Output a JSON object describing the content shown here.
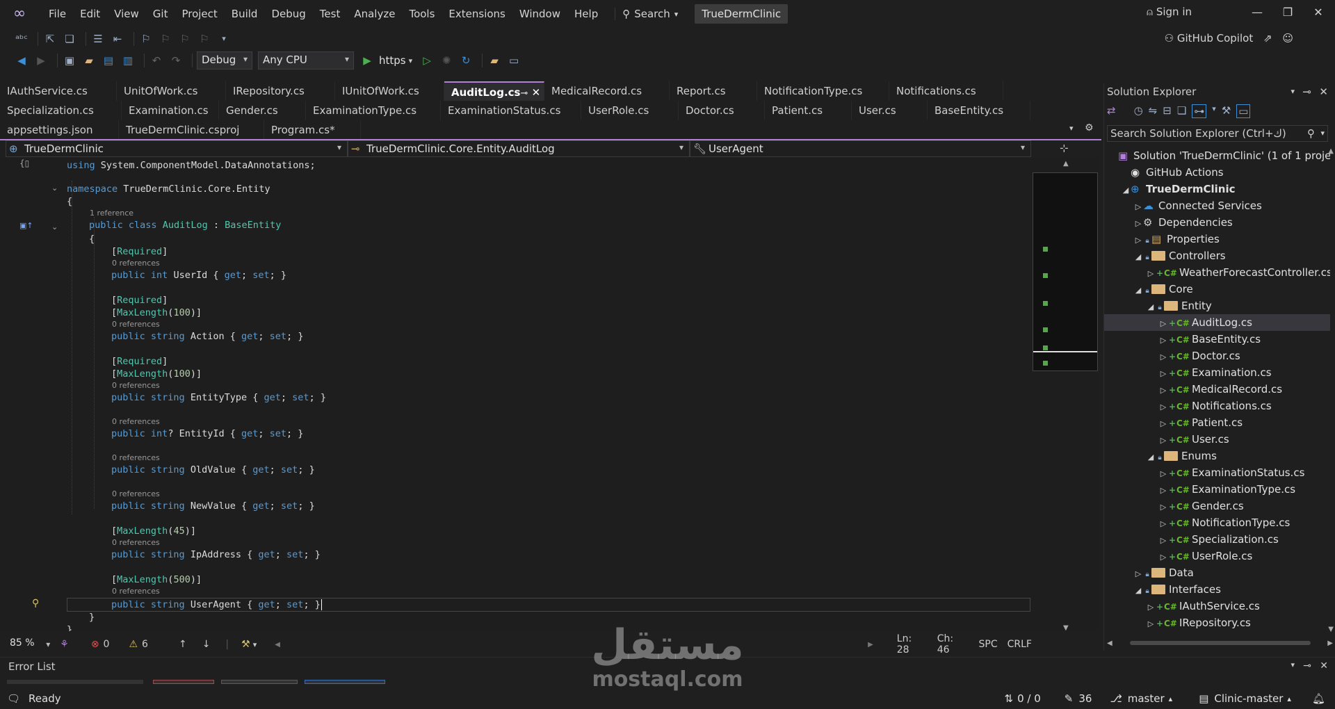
{
  "menu": {
    "items": [
      "File",
      "Edit",
      "View",
      "Git",
      "Project",
      "Build",
      "Debug",
      "Test",
      "Analyze",
      "Tools",
      "Extensions",
      "Window",
      "Help"
    ],
    "search": "Search",
    "solution_name": "TrueDermClinic",
    "sign_in": "Sign in"
  },
  "toolbar": {
    "config": "Debug",
    "platform": "Any CPU",
    "run_profile": "https",
    "copilot": "GitHub Copilot"
  },
  "tabs": {
    "row1": [
      "IAuthService.cs",
      "UnitOfWork.cs",
      "IRepository.cs",
      "IUnitOfWork.cs",
      "AuditLog.cs",
      "MedicalRecord.cs",
      "Report.cs",
      "NotificationType.cs",
      "Notifications.cs"
    ],
    "row2": [
      "Specialization.cs",
      "Examination.cs",
      "Gender.cs",
      "ExaminationType.cs",
      "ExaminationStatus.cs",
      "UserRole.cs",
      "Doctor.cs",
      "Patient.cs",
      "User.cs",
      "BaseEntity.cs"
    ],
    "row3": [
      "appsettings.json",
      "TrueDermClinic.csproj",
      "Program.cs*"
    ],
    "active": "AuditLog.cs"
  },
  "navbar": {
    "project": "TrueDermClinic",
    "type": "TrueDermClinic.Core.Entity.AuditLog",
    "member": "UserAgent"
  },
  "code": {
    "using_kw": "using",
    "using_ns": "System.ComponentModel.DataAnnotations;",
    "namespace_kw": "namespace",
    "namespace_name": "TrueDermClinic.Core.Entity",
    "class_ref": "1 reference",
    "class_decl_kw": "public class",
    "class_name": "AuditLog",
    "class_base": "BaseEntity",
    "zero_refs": "0 references",
    "attr_required": "Required",
    "attr_maxlength": "MaxLength",
    "kw_public": "public",
    "kw_int": "int",
    "kw_string": "string",
    "kw_get": "get",
    "kw_set": "set",
    "maxlen_100": "100",
    "maxlen_45": "45",
    "maxlen_500": "500",
    "props": [
      "UserId",
      "Action",
      "EntityType",
      "EntityId",
      "OldValue",
      "NewValue",
      "IpAddress",
      "UserAgent"
    ]
  },
  "editor_status": {
    "zoom": "85 %",
    "errors": "0",
    "warnings": "6",
    "line": "Ln: 28",
    "col": "Ch: 46",
    "spacing": "SPC",
    "eol": "CRLF"
  },
  "solution_explorer": {
    "title": "Solution Explorer",
    "search_placeholder": "Search Solution Explorer (Ctrl+ك)",
    "items": [
      {
        "label": "Solution 'TrueDermClinic' (1 of 1 project)",
        "indent": 0,
        "kind": "solution"
      },
      {
        "label": "GitHub Actions",
        "indent": 1,
        "kind": "github"
      },
      {
        "label": "TrueDermClinic",
        "indent": 1,
        "kind": "project"
      },
      {
        "label": "Connected Services",
        "indent": 2,
        "kind": "service"
      },
      {
        "label": "Dependencies",
        "indent": 2,
        "kind": "deps"
      },
      {
        "label": "Properties",
        "indent": 2,
        "kind": "props"
      },
      {
        "label": "Controllers",
        "indent": 2,
        "kind": "folder"
      },
      {
        "label": "WeatherForecastController.cs",
        "indent": 3,
        "kind": "cs"
      },
      {
        "label": "Core",
        "indent": 2,
        "kind": "folder"
      },
      {
        "label": "Entity",
        "indent": 3,
        "kind": "folder"
      },
      {
        "label": "AuditLog.cs",
        "indent": 4,
        "kind": "cs",
        "selected": true
      },
      {
        "label": "BaseEntity.cs",
        "indent": 4,
        "kind": "cs"
      },
      {
        "label": "Doctor.cs",
        "indent": 4,
        "kind": "cs"
      },
      {
        "label": "Examination.cs",
        "indent": 4,
        "kind": "cs"
      },
      {
        "label": "MedicalRecord.cs",
        "indent": 4,
        "kind": "cs"
      },
      {
        "label": "Notifications.cs",
        "indent": 4,
        "kind": "cs"
      },
      {
        "label": "Patient.cs",
        "indent": 4,
        "kind": "cs"
      },
      {
        "label": "User.cs",
        "indent": 4,
        "kind": "cs"
      },
      {
        "label": "Enums",
        "indent": 3,
        "kind": "folder"
      },
      {
        "label": "ExaminationStatus.cs",
        "indent": 4,
        "kind": "cs"
      },
      {
        "label": "ExaminationType.cs",
        "indent": 4,
        "kind": "cs"
      },
      {
        "label": "Gender.cs",
        "indent": 4,
        "kind": "cs"
      },
      {
        "label": "NotificationType.cs",
        "indent": 4,
        "kind": "cs"
      },
      {
        "label": "Specialization.cs",
        "indent": 4,
        "kind": "cs"
      },
      {
        "label": "UserRole.cs",
        "indent": 4,
        "kind": "cs"
      },
      {
        "label": "Data",
        "indent": 2,
        "kind": "folder"
      },
      {
        "label": "Interfaces",
        "indent": 2,
        "kind": "folder"
      },
      {
        "label": "IAuthService.cs",
        "indent": 3,
        "kind": "cs"
      },
      {
        "label": "IRepository.cs",
        "indent": 3,
        "kind": "cs"
      }
    ]
  },
  "error_list": {
    "title": "Error List"
  },
  "statusbar": {
    "ready": "Ready",
    "sync": "0 / 0",
    "pencil_count": "36",
    "branch": "master",
    "repo": "Clinic-master"
  },
  "watermark": {
    "arabic": "مستقل",
    "latin": "mostaql.com"
  }
}
